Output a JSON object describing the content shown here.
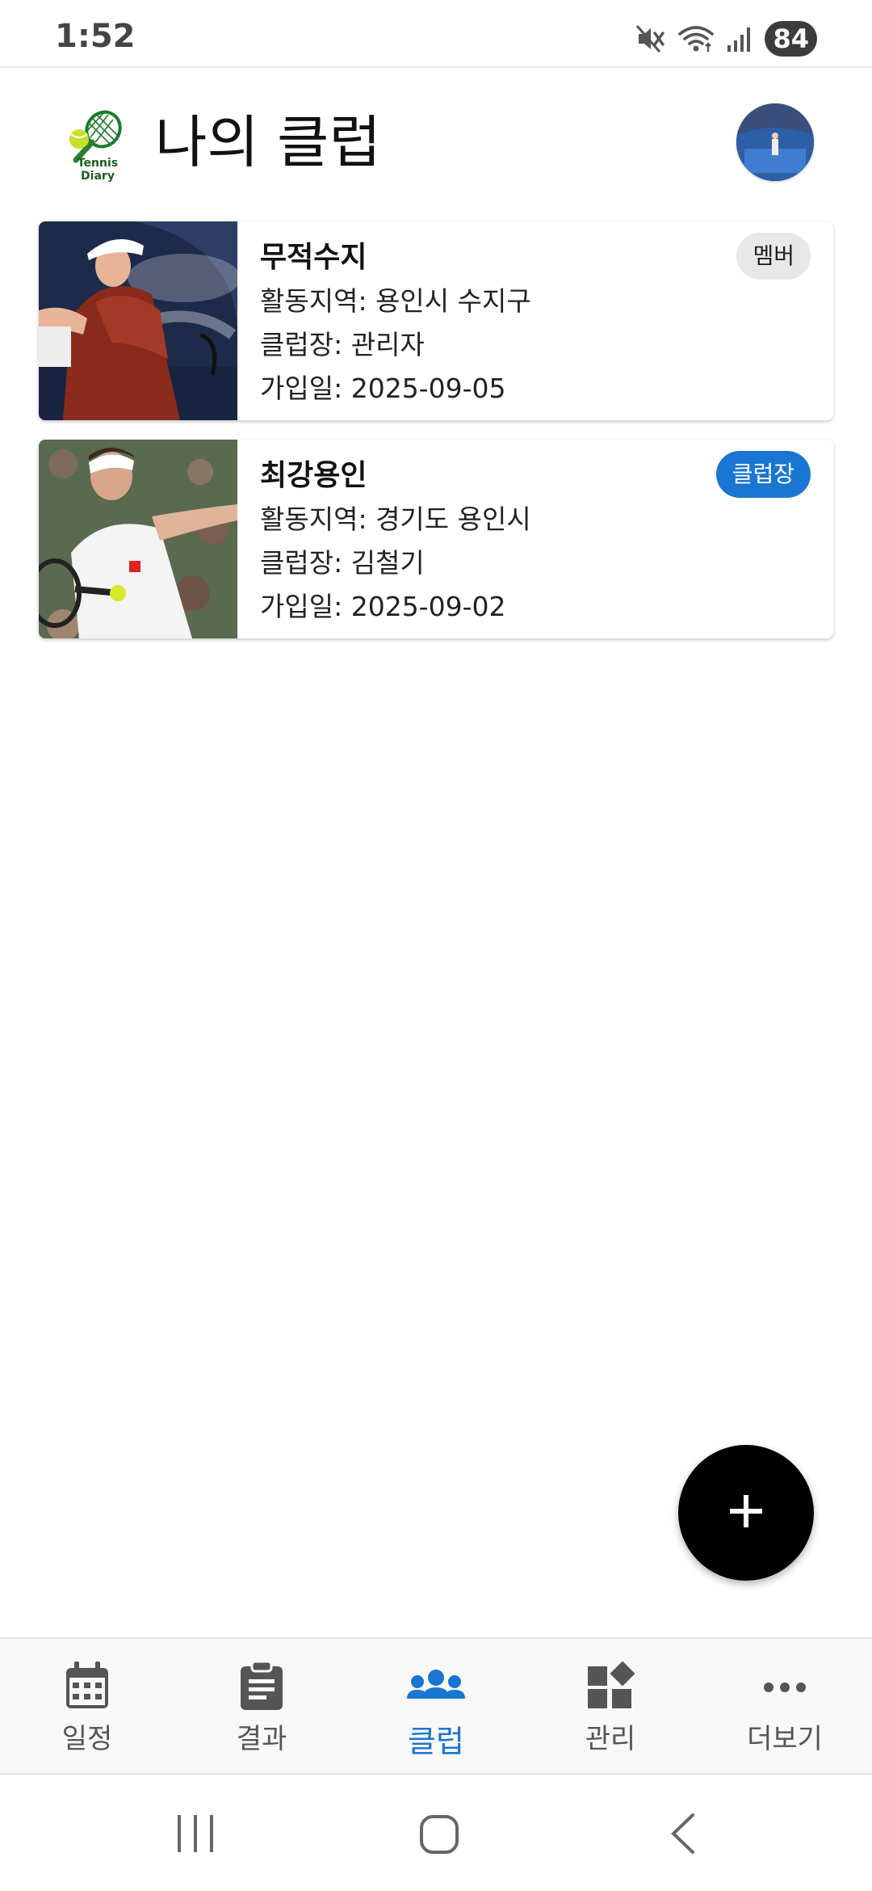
{
  "status_bar": {
    "time": "1:52",
    "battery": "84",
    "icons": [
      "mute-icon",
      "wifi-icon",
      "signal-icon"
    ]
  },
  "header": {
    "logo_text": "Tennis Diary",
    "title": "나의 클럽"
  },
  "clubs": [
    {
      "name": "무적수지",
      "region_label": "활동지역: ",
      "region": "용인시 수지구",
      "leader_label": "클럽장: ",
      "leader": "관리자",
      "joined_label": "가입일: ",
      "joined": "2025-09-05",
      "role": "멤버"
    },
    {
      "name": "최강용인",
      "region_label": "활동지역: ",
      "region": "경기도 용인시",
      "leader_label": "클럽장: ",
      "leader": "김철기",
      "joined_label": "가입일: ",
      "joined": "2025-09-02",
      "role": "클럽장"
    }
  ],
  "fab": {
    "icon": "plus-icon"
  },
  "bottom_nav": {
    "items": [
      {
        "label": "일정",
        "icon": "calendar-icon"
      },
      {
        "label": "결과",
        "icon": "clipboard-icon"
      },
      {
        "label": "클럽",
        "icon": "group-icon",
        "active": true
      },
      {
        "label": "관리",
        "icon": "widgets-icon"
      },
      {
        "label": "더보기",
        "icon": "more-icon"
      }
    ]
  },
  "colors": {
    "accent": "#1976d2",
    "leader_badge": "#1976d2",
    "member_badge": "#e8e8e8",
    "fab": "#000000"
  }
}
